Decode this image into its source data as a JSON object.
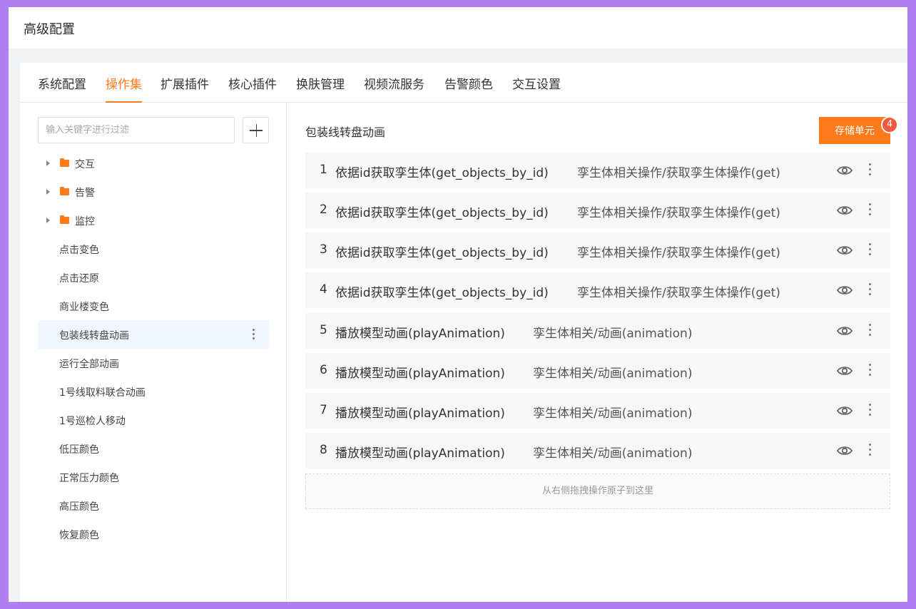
{
  "window": {
    "title": "高级配置"
  },
  "tabs": [
    {
      "label": "系统配置"
    },
    {
      "label": "操作集"
    },
    {
      "label": "扩展插件"
    },
    {
      "label": "核心插件"
    },
    {
      "label": "换肤管理"
    },
    {
      "label": "视频流服务"
    },
    {
      "label": "告警颜色"
    },
    {
      "label": "交互设置"
    }
  ],
  "active_tab": "操作集",
  "sidebar": {
    "search_placeholder": "输入关键字进行过滤",
    "folders": [
      {
        "label": "交互"
      },
      {
        "label": "告警"
      },
      {
        "label": "监控"
      }
    ],
    "items": [
      {
        "label": "点击变色"
      },
      {
        "label": "点击还原"
      },
      {
        "label": "商业楼变色"
      },
      {
        "label": "包装线转盘动画"
      },
      {
        "label": "运行全部动画"
      },
      {
        "label": "1号线取料联合动画"
      },
      {
        "label": "1号巡检人移动"
      },
      {
        "label": "低压颜色"
      },
      {
        "label": "正常压力颜色"
      },
      {
        "label": "高压颜色"
      },
      {
        "label": "恢复颜色"
      }
    ],
    "selected_item": "包装线转盘动画"
  },
  "content": {
    "heading": "包装线转盘动画",
    "store_button": "存储单元",
    "badge_count": "4",
    "operations": [
      {
        "num": "1",
        "name": "依据id获取孪生体(get_objects_by_id)",
        "path": "孪生体相关操作/获取孪生体操作(get)"
      },
      {
        "num": "2",
        "name": "依据id获取孪生体(get_objects_by_id)",
        "path": "孪生体相关操作/获取孪生体操作(get)"
      },
      {
        "num": "3",
        "name": "依据id获取孪生体(get_objects_by_id)",
        "path": "孪生体相关操作/获取孪生体操作(get)"
      },
      {
        "num": "4",
        "name": "依据id获取孪生体(get_objects_by_id)",
        "path": "孪生体相关操作/获取孪生体操作(get)"
      },
      {
        "num": "5",
        "name": "播放模型动画(playAnimation)",
        "path": "孪生体相关/动画(animation)"
      },
      {
        "num": "6",
        "name": "播放模型动画(playAnimation)",
        "path": "孪生体相关/动画(animation)"
      },
      {
        "num": "7",
        "name": "播放模型动画(playAnimation)",
        "path": "孪生体相关/动画(animation)"
      },
      {
        "num": "8",
        "name": "播放模型动画(playAnimation)",
        "path": "孪生体相关/动画(animation)"
      }
    ],
    "dropzone_text": "从右侧拖拽操作原子到这里"
  },
  "colors": {
    "accent": "#ff7a1a",
    "badge": "#f0593e",
    "frame_border": "#b07ff0",
    "selected_bg": "#f0f5fe"
  },
  "icons": [
    "plus-icon",
    "caret-right-icon",
    "folder-icon",
    "eye-icon",
    "more-vertical-icon"
  ]
}
